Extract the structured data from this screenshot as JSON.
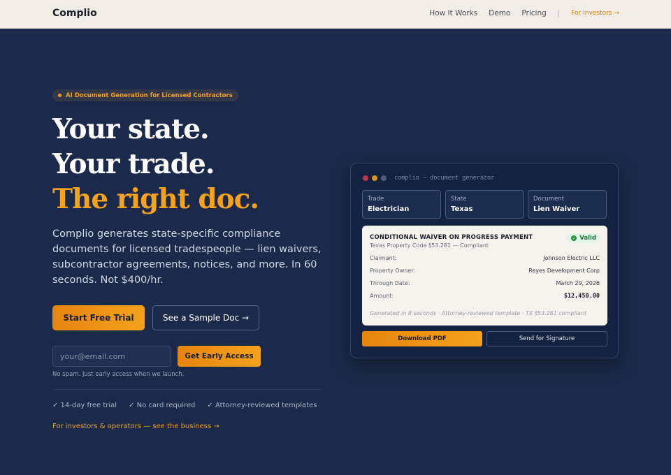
{
  "header": {
    "logo": "Complio",
    "nav": [
      "How It Works",
      "Demo",
      "Pricing"
    ],
    "separator": "|",
    "investors_link": "For Investors →"
  },
  "hero": {
    "badge": "AI Document Generation for Licensed Contractors",
    "headline": [
      "Your state.",
      "Your trade.",
      "The right doc."
    ],
    "description": "Complio generates state-specific compliance documents for licensed tradespeople — lien waivers, subcontractor agreements, notices, and more. In 60 seconds. Not $400/hr.",
    "primary_cta": "Start Free Trial",
    "secondary_cta": "See a Sample Doc →",
    "email_placeholder": "your@email.com",
    "email_value": "",
    "access_button": "Get Early Access",
    "nospam": "No spam. Just early access when we launch.",
    "checks": [
      "✓ 14-day free trial",
      "✓ No card required",
      "✓ Attorney-reviewed templates"
    ],
    "investor_link": "For investors & operators — see the business →"
  },
  "demo": {
    "terminal_title": "complio — document generator",
    "selectors": [
      {
        "label": "Trade",
        "value": "Electrician"
      },
      {
        "label": "State",
        "value": "Texas"
      },
      {
        "label": "Document",
        "value": "Lien Waiver"
      }
    ],
    "document": {
      "title": "CONDITIONAL WAIVER ON PROGRESS PAYMENT",
      "subtitle": "Texas Property Code §53.281 — Compliant",
      "status": "Valid",
      "rows": [
        {
          "label": "Claimant:",
          "value": "Johnson Electric LLC"
        },
        {
          "label": "Property Owner:",
          "value": "Reyes Development Corp"
        },
        {
          "label": "Through Date:",
          "value": "March 29, 2026"
        },
        {
          "label": "Amount:",
          "value": "$12,450.00"
        }
      ],
      "footer": "Generated in 8 seconds · Attorney-reviewed template · TX §53.281 compliant"
    },
    "download_button": "Download PDF",
    "sign_button": "Send for Signature"
  },
  "colors": {
    "background": "#1b2a4a",
    "accent": "#f5a21d",
    "header_bg": "#f1ede6",
    "valid_green": "#22934a"
  }
}
